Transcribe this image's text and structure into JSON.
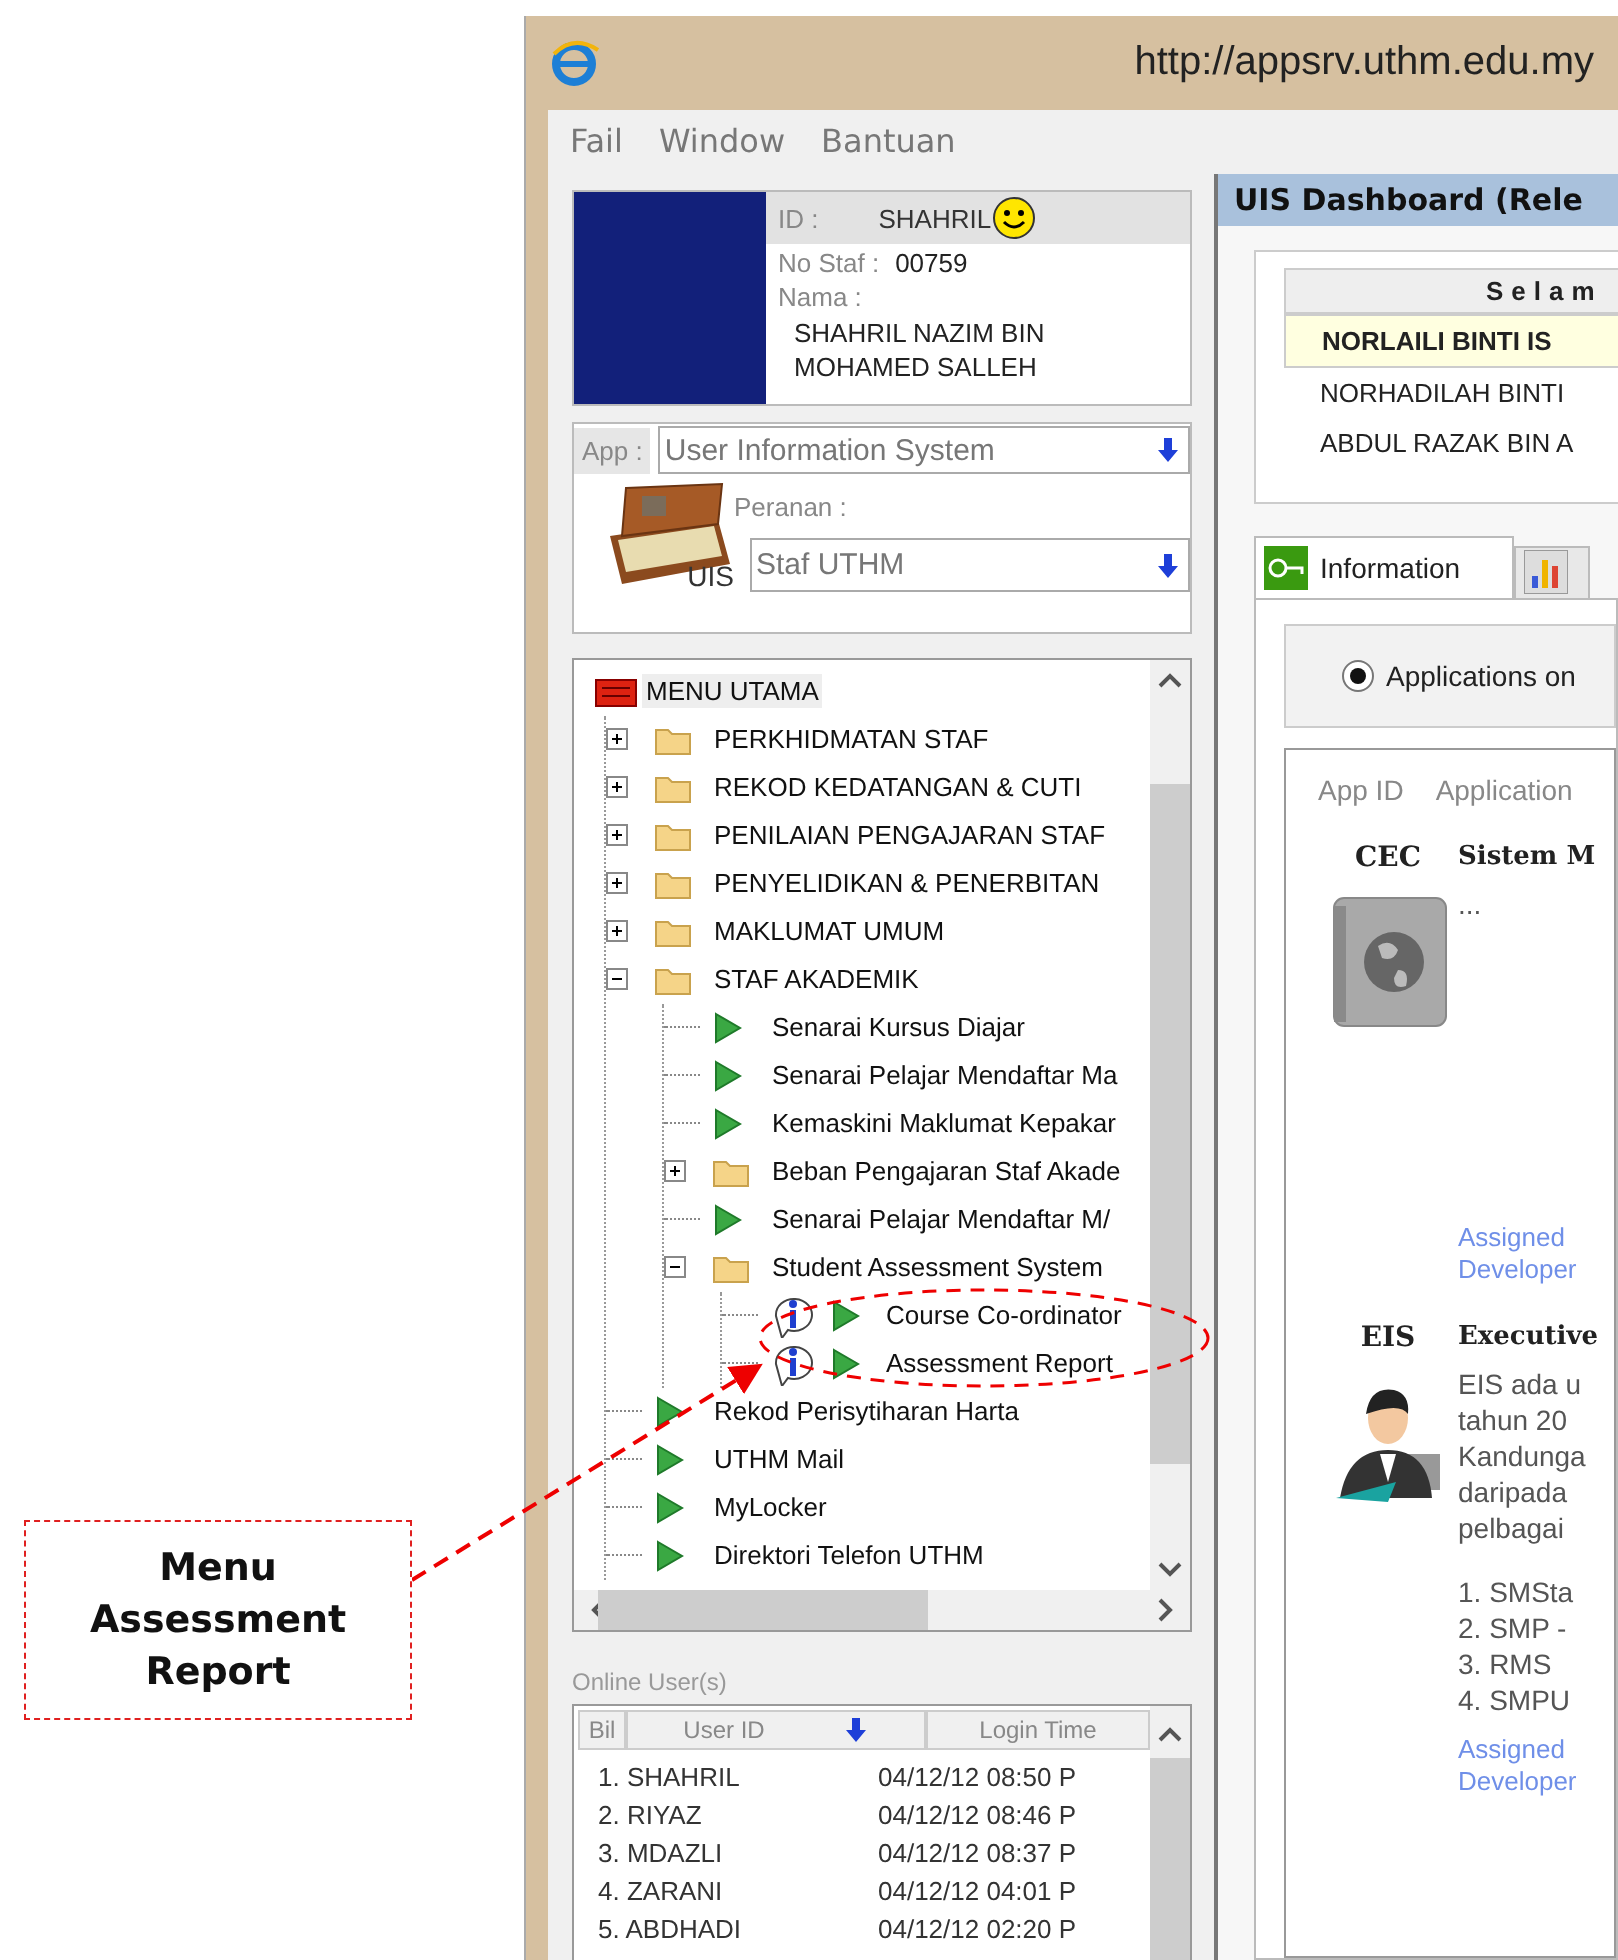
{
  "window": {
    "title": "http://appsrv.uthm.edu.my"
  },
  "menu_bar": [
    "Fail",
    "Window",
    "Bantuan"
  ],
  "profile": {
    "id_label": "ID :",
    "id": "SHAHRIL",
    "staff_no_label": "No Staf :",
    "staff_no": "00759",
    "name_label": "Nama :",
    "name": "SHAHRIL NAZIM BIN MOHAMED SALLEH"
  },
  "app_selector": {
    "label": "App :",
    "value": "User Information System",
    "role_label": "Peranan :",
    "role": "Staf UTHM",
    "logo_caption": "UIS"
  },
  "menu_tree": {
    "root": "MENU UTAMA",
    "children": [
      {
        "label": "PERKHIDMATAN STAF",
        "kind": "folder",
        "expanded": false
      },
      {
        "label": "REKOD KEDATANGAN & CUTI",
        "kind": "folder",
        "expanded": false
      },
      {
        "label": "PENILAIAN PENGAJARAN STAF",
        "kind": "folder",
        "expanded": false
      },
      {
        "label": "PENYELIDIKAN & PENERBITAN",
        "kind": "folder",
        "expanded": false
      },
      {
        "label": "MAKLUMAT UMUM",
        "kind": "folder",
        "expanded": false
      },
      {
        "label": "STAF AKADEMIK",
        "kind": "folder",
        "expanded": true,
        "children": [
          {
            "label": "Senarai Kursus Diajar",
            "kind": "item"
          },
          {
            "label": "Senarai Pelajar Mendaftar Ma",
            "kind": "item"
          },
          {
            "label": "Kemaskini Maklumat Kepakar",
            "kind": "item"
          },
          {
            "label": "Beban Pengajaran Staf Akade",
            "kind": "folder",
            "expanded": false
          },
          {
            "label": "Senarai Pelajar Mendaftar M/",
            "kind": "item"
          },
          {
            "label": "Student Assessment System",
            "kind": "folder",
            "expanded": true,
            "children": [
              {
                "label": "Course Co-ordinator",
                "kind": "info-item"
              },
              {
                "label": "Assessment Report",
                "kind": "info-item"
              }
            ]
          }
        ]
      },
      {
        "label": "Rekod Perisytiharan Harta",
        "kind": "item"
      },
      {
        "label": "UTHM Mail",
        "kind": "item"
      },
      {
        "label": "MyLocker",
        "kind": "item"
      },
      {
        "label": "Direktori Telefon UTHM",
        "kind": "item"
      }
    ]
  },
  "online_users": {
    "title": "Online User(s)",
    "columns": [
      "Bil",
      "User ID",
      "Login Time"
    ],
    "rows": [
      [
        "1.",
        "SHAHRIL",
        "04/12/12 08:50 P"
      ],
      [
        "2.",
        "RIYAZ",
        "04/12/12 08:46 P"
      ],
      [
        "3.",
        "MDAZLI",
        "04/12/12 08:37 P"
      ],
      [
        "4.",
        "ZARANI",
        "04/12/12 04:01 P"
      ],
      [
        "5.",
        "ABDHADI",
        "04/12/12 02:20 P"
      ]
    ]
  },
  "dashboard": {
    "title": "UIS Dashboard (Rele",
    "staff_table": {
      "header": "Selam",
      "rows": [
        {
          "name": "NORLAILI BINTI IS",
          "selected": true
        },
        {
          "name": "NORHADILAH BINTI",
          "selected": false
        },
        {
          "name": "ABDUL RAZAK BIN A",
          "selected": false
        }
      ]
    },
    "tabs": [
      {
        "label": "Information",
        "kind": "key",
        "selected": true
      },
      {
        "kind": "chart",
        "selected": false
      }
    ],
    "radio": {
      "label": "Applications on",
      "selected": true
    },
    "apps": {
      "columns": [
        "App ID",
        "Application"
      ],
      "rows": [
        {
          "id": "CEC",
          "name": "Sistem M",
          "kind": "globe",
          "description": [
            "..."
          ],
          "link": "Assigned Developer"
        },
        {
          "id": "EIS",
          "name": "Executive",
          "kind": "person",
          "description": [
            "EIS ada u",
            "tahun 20",
            "Kandunga",
            "daripada",
            "pelbagai"
          ],
          "list": [
            "1. SMSta",
            "2. SMP -",
            "3. RMS",
            "4. SMPU"
          ],
          "link": "Assigned Developer"
        }
      ]
    }
  },
  "annotation": {
    "text": "Menu Assessment Report"
  }
}
